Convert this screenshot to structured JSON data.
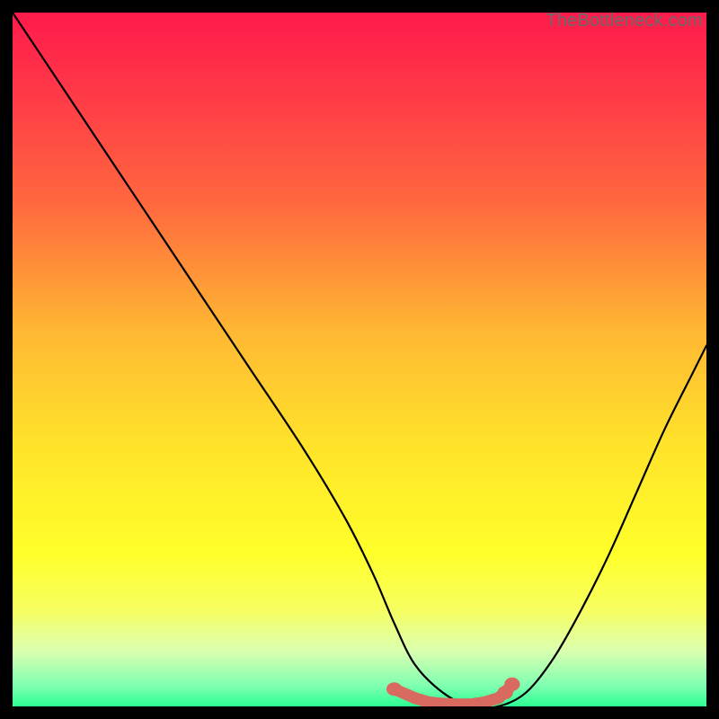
{
  "watermark": "TheBottleneck.com",
  "chart_data": {
    "type": "line",
    "title": "",
    "xlabel": "",
    "ylabel": "",
    "xlim": [
      0,
      100
    ],
    "ylim": [
      0,
      100
    ],
    "gradient_stops": [
      {
        "offset": 0.0,
        "color": "#ff1a4b"
      },
      {
        "offset": 0.12,
        "color": "#ff3a47"
      },
      {
        "offset": 0.28,
        "color": "#ff6a3e"
      },
      {
        "offset": 0.46,
        "color": "#ffb833"
      },
      {
        "offset": 0.62,
        "color": "#ffe22a"
      },
      {
        "offset": 0.78,
        "color": "#ffff2a"
      },
      {
        "offset": 0.86,
        "color": "#f7ff60"
      },
      {
        "offset": 0.92,
        "color": "#daffb0"
      },
      {
        "offset": 0.97,
        "color": "#7fffb0"
      },
      {
        "offset": 1.0,
        "color": "#2bff94"
      }
    ],
    "series": [
      {
        "name": "bottleneck-curve",
        "type": "line",
        "x": [
          0,
          4,
          8,
          12,
          18,
          26,
          34,
          42,
          48,
          52,
          55,
          58,
          62,
          66,
          70,
          74,
          78,
          82,
          86,
          90,
          94,
          98,
          100
        ],
        "y": [
          100,
          94,
          88,
          82,
          73,
          61,
          49,
          37,
          27,
          19,
          12,
          6,
          2,
          0,
          0,
          2,
          7,
          14,
          22,
          31,
          40,
          48,
          52
        ]
      },
      {
        "name": "highlight-dots",
        "type": "scatter",
        "x": [
          55,
          58,
          60,
          62,
          64,
          66,
          68,
          70,
          71,
          72
        ],
        "y": [
          2.5,
          1.2,
          0.6,
          0.4,
          0.3,
          0.3,
          0.6,
          1.2,
          2.0,
          3.2
        ],
        "color": "#d86a60"
      }
    ]
  }
}
